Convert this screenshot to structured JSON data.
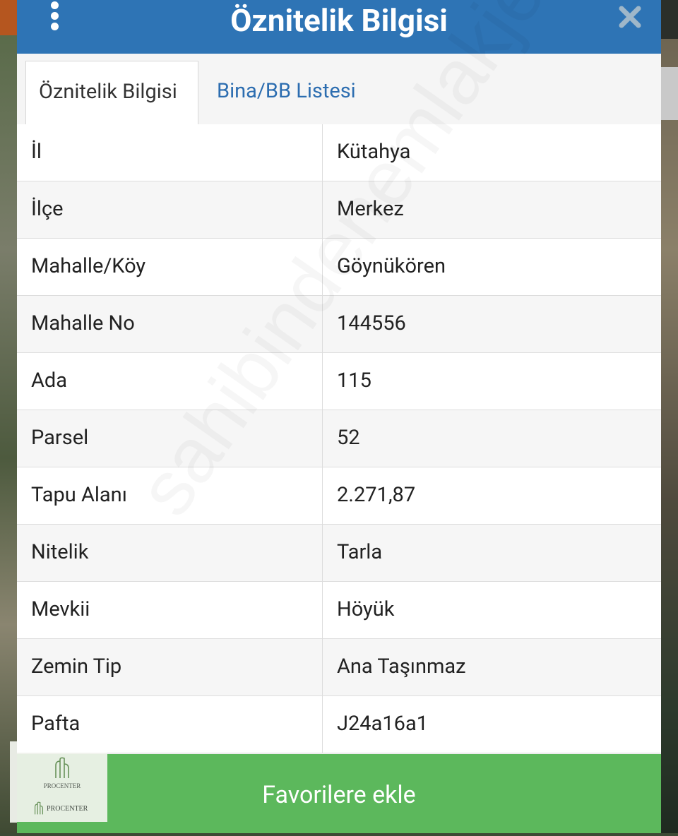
{
  "header": {
    "title": "Öznitelik Bilgisi"
  },
  "tabs": [
    {
      "label": "Öznitelik Bilgisi",
      "active": true
    },
    {
      "label": "Bina/BB Listesi",
      "active": false
    }
  ],
  "attributes": [
    {
      "label": "İl",
      "value": "Kütahya"
    },
    {
      "label": "İlçe",
      "value": "Merkez"
    },
    {
      "label": "Mahalle/Köy",
      "value": "Göynükören"
    },
    {
      "label": "Mahalle No",
      "value": "144556"
    },
    {
      "label": "Ada",
      "value": "115"
    },
    {
      "label": "Parsel",
      "value": "52"
    },
    {
      "label": "Tapu Alanı",
      "value": "2.271,87"
    },
    {
      "label": "Nitelik",
      "value": "Tarla"
    },
    {
      "label": "Mevkii",
      "value": "Höyük"
    },
    {
      "label": "Zemin Tip",
      "value": "Ana Taşınmaz"
    },
    {
      "label": "Pafta",
      "value": "J24a16a1"
    }
  ],
  "footer": {
    "button_label": "Favorilere ekle"
  },
  "logo": {
    "brand": "PROCENTER"
  },
  "watermark": "sahibindenemlakjet.com",
  "colors": {
    "header": "#2e74b5",
    "tab_link": "#2c6db0",
    "button": "#5cb85c"
  }
}
